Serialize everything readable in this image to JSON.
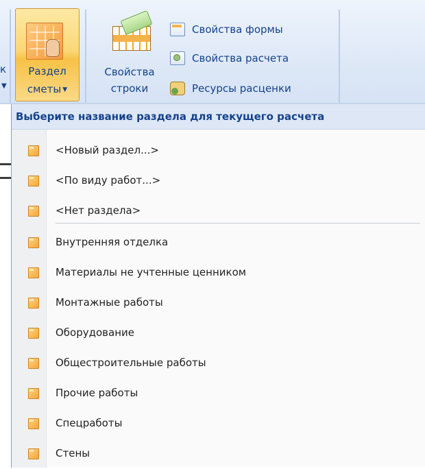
{
  "ribbon": {
    "clipped_label": "к",
    "section_button": {
      "line1": "Раздел",
      "line2": "сметы"
    },
    "row_props_button": {
      "line1": "Свойства",
      "line2": "строки"
    },
    "small_buttons": [
      {
        "label": "Свойства формы",
        "icon": "form-properties-icon"
      },
      {
        "label": "Свойства расчета",
        "icon": "calc-properties-icon"
      },
      {
        "label": "Ресурсы расценки",
        "icon": "price-resources-icon"
      }
    ]
  },
  "dropdown": {
    "header": "Выберите название раздела для текущего расчета",
    "special_items": [
      {
        "label": "<Новый раздел...>"
      },
      {
        "label": "<По виду работ...>"
      },
      {
        "label": "<Нет раздела>"
      }
    ],
    "items": [
      {
        "label": "Внутренняя отделка"
      },
      {
        "label": "Материалы не учтенные ценником"
      },
      {
        "label": "Монтажные работы"
      },
      {
        "label": "Оборудование"
      },
      {
        "label": "Общестроительные работы"
      },
      {
        "label": "Прочие работы"
      },
      {
        "label": "Спецработы"
      },
      {
        "label": "Стены"
      }
    ]
  }
}
